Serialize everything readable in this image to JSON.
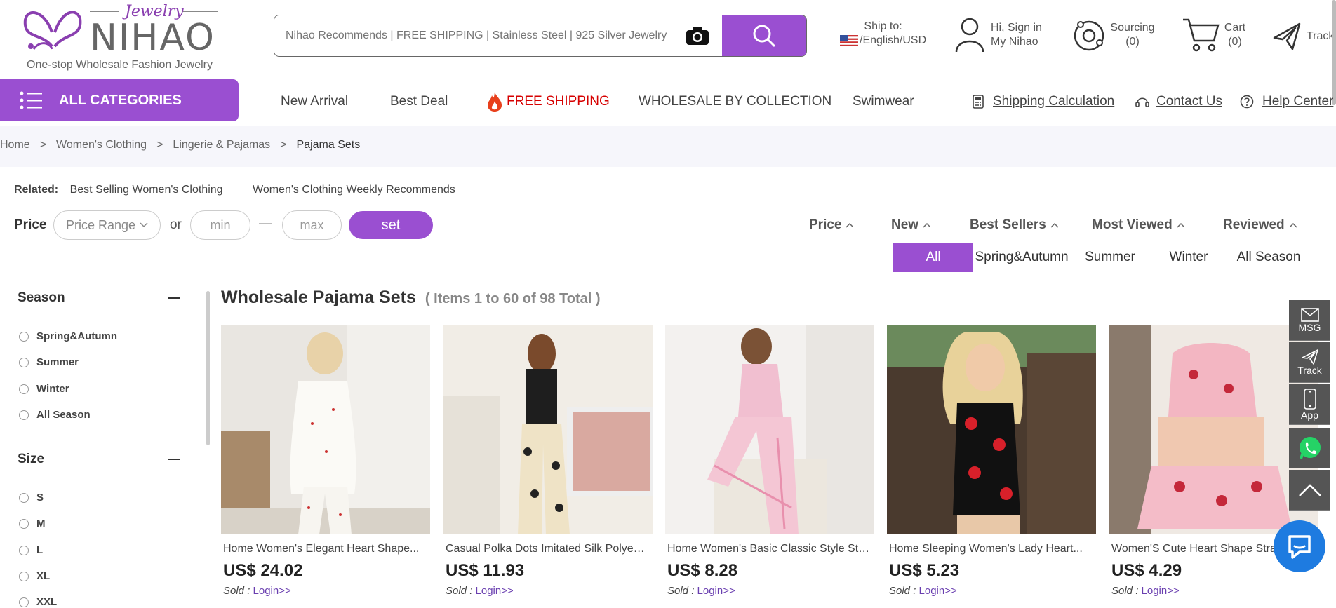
{
  "header": {
    "logo": {
      "script": "Jewelry",
      "brand": "NIHAO",
      "tagline": "One-stop Wholesale Fashion Jewelry"
    },
    "search": {
      "placeholder": "Nihao Recommends | FREE SHIPPING | Stainless Steel | 925 Silver Jewelry",
      "camera_icon": "camera-icon",
      "search_icon": "search-icon"
    },
    "ship_to": {
      "label": "Ship to:",
      "value": "/English/USD"
    },
    "account": {
      "line1": "Hi, Sign in",
      "line2": "My Nihao"
    },
    "sourcing": {
      "label": "Sourcing",
      "count": "(0)"
    },
    "cart": {
      "label": "Cart",
      "count": "(0)"
    },
    "track": {
      "label": "Track"
    }
  },
  "nav": {
    "all_categories": "ALL CATEGORIES",
    "items": [
      "New Arrival",
      "Best Deal",
      "FREE SHIPPING",
      "WHOLESALE BY COLLECTION",
      "Swimwear"
    ],
    "right": [
      "Shipping Calculation",
      "Contact Us",
      "Help Center"
    ]
  },
  "breadcrumb": [
    "Home",
    "Women's Clothing",
    "Lingerie & Pajamas",
    "Pajama Sets"
  ],
  "related": {
    "label": "Related:",
    "links": [
      "Best Selling Women's Clothing",
      "Women's Clothing Weekly Recommends"
    ]
  },
  "price_filter": {
    "label": "Price",
    "range_label": "Price Range",
    "or": "or",
    "min_placeholder": "min",
    "max_placeholder": "max",
    "dash": "—",
    "set": "set"
  },
  "sort": [
    "Price",
    "New",
    "Best Sellers",
    "Most Viewed",
    "Reviewed"
  ],
  "season_tabs": {
    "items": [
      "All",
      "Spring&Autumn",
      "Summer",
      "Winter",
      "All Season"
    ],
    "active": "All"
  },
  "sidebar": {
    "season": {
      "title": "Season",
      "options": [
        "Spring&Autumn",
        "Summer",
        "Winter",
        "All Season"
      ]
    },
    "size": {
      "title": "Size",
      "options": [
        "S",
        "M",
        "L",
        "XL",
        "XXL"
      ]
    }
  },
  "listing": {
    "title": "Wholesale Pajama Sets",
    "count": "( Items 1 to 60 of 98 Total )"
  },
  "products": [
    {
      "name": "Home Women's Elegant Heart Shape...",
      "price": "US$ 24.02",
      "sold_label": "Sold :",
      "login": "Login>>"
    },
    {
      "name": "Casual Polka Dots Imitated Silk Polyest...",
      "price": "US$ 11.93",
      "sold_label": "Sold :",
      "login": "Login>>"
    },
    {
      "name": "Home Women's Basic Classic Style Stri...",
      "price": "US$ 8.28",
      "sold_label": "Sold :",
      "login": "Login>>"
    },
    {
      "name": "Home Sleeping Women's Lady Heart...",
      "price": "US$ 5.23",
      "sold_label": "Sold :",
      "login": "Login>>"
    },
    {
      "name": "Women'S Cute Heart Shape Stra...",
      "price": "US$ 4.29",
      "sold_label": "Sold :",
      "login": "Login>>"
    }
  ],
  "floating": {
    "msg": "MSG",
    "track": "Track",
    "app": "App"
  },
  "colors": {
    "accent": "#9a4fd1",
    "free_shipping": "#d60000",
    "chat": "#1e7be0",
    "float_bg": "#555555"
  }
}
